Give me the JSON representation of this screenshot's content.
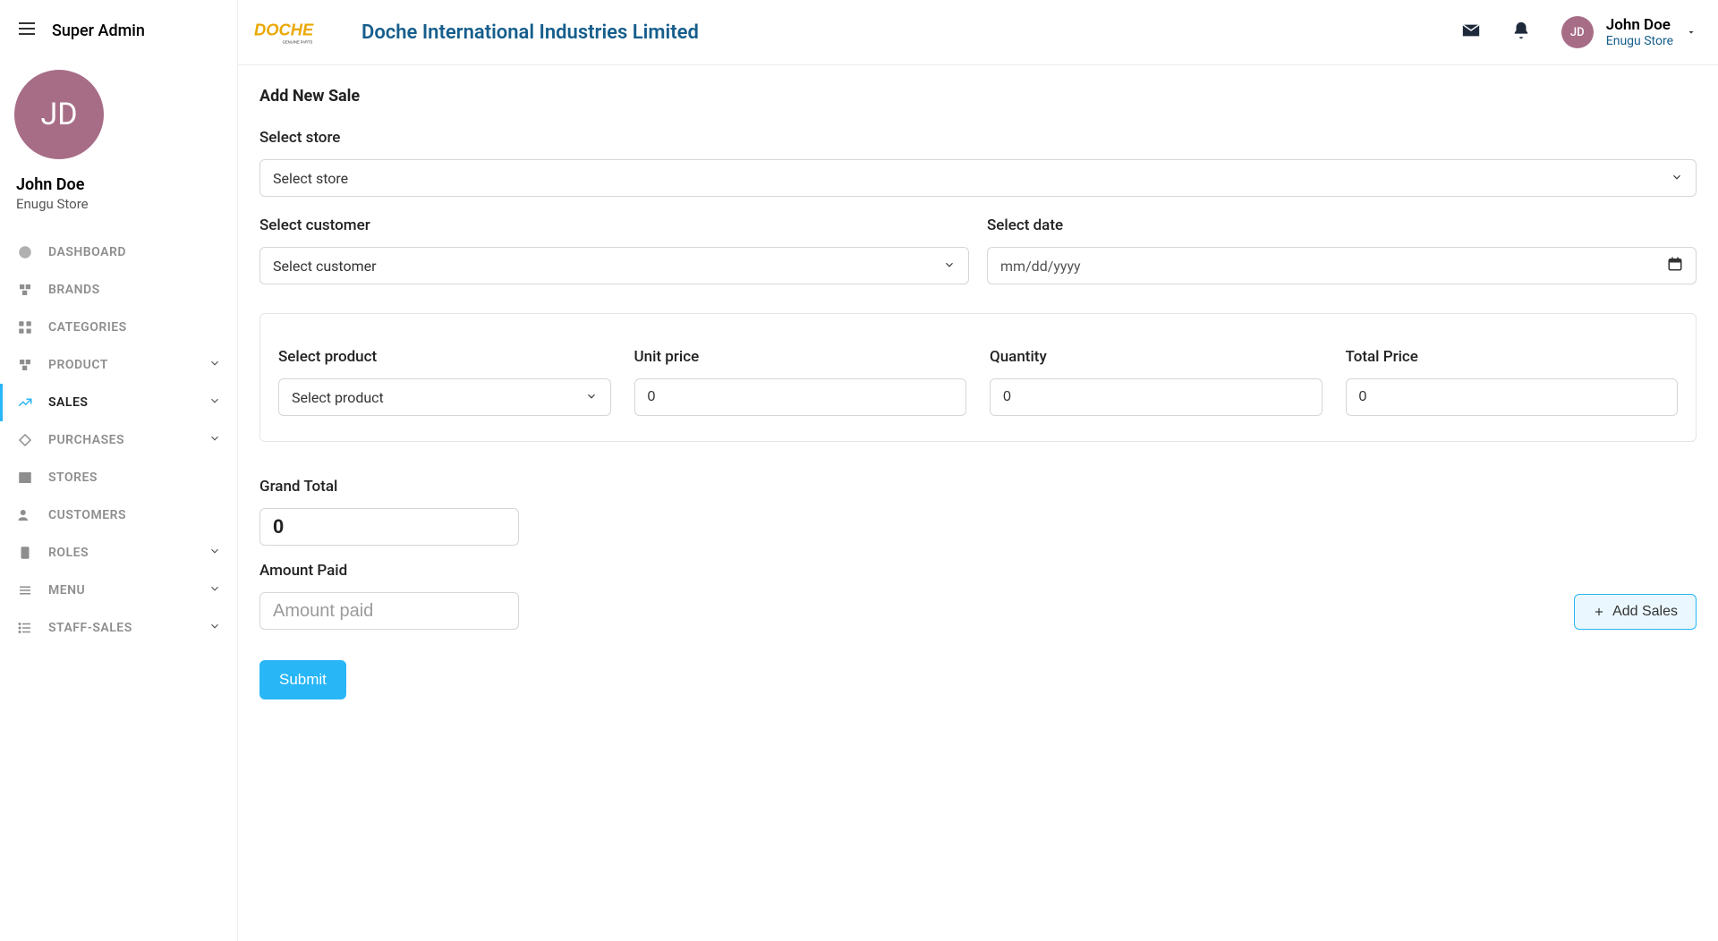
{
  "sidebar": {
    "title": "Super Admin",
    "avatar_initials": "JD",
    "user_name": "John Doe",
    "user_store": "Enugu Store",
    "items": [
      {
        "label": "Dashboard",
        "icon": "dashboard",
        "expandable": false,
        "active": false
      },
      {
        "label": "Brands",
        "icon": "brands",
        "expandable": false,
        "active": false
      },
      {
        "label": "Categories",
        "icon": "categories",
        "expandable": false,
        "active": false
      },
      {
        "label": "Product",
        "icon": "product",
        "expandable": true,
        "active": false
      },
      {
        "label": "Sales",
        "icon": "sales",
        "expandable": true,
        "active": true
      },
      {
        "label": "Purchases",
        "icon": "purchases",
        "expandable": true,
        "active": false
      },
      {
        "label": "Stores",
        "icon": "stores",
        "expandable": false,
        "active": false
      },
      {
        "label": "Customers",
        "icon": "customers",
        "expandable": false,
        "active": false
      },
      {
        "label": "Roles",
        "icon": "roles",
        "expandable": true,
        "active": false
      },
      {
        "label": "Menu",
        "icon": "menu",
        "expandable": true,
        "active": false
      },
      {
        "label": "Staff-Sales",
        "icon": "list",
        "expandable": true,
        "active": false
      }
    ]
  },
  "topbar": {
    "company": "Doche International Industries Limited",
    "user_avatar_initials": "JD",
    "user_name": "John Doe",
    "user_store": "Enugu Store"
  },
  "page": {
    "title": "Add New Sale",
    "labels": {
      "select_store": "Select store",
      "select_customer": "Select customer",
      "select_date": "Select date",
      "select_product": "Select product",
      "unit_price": "Unit price",
      "quantity": "Quantity",
      "total_price": "Total Price",
      "grand_total": "Grand Total",
      "amount_paid": "Amount Paid"
    },
    "placeholders": {
      "select_store": "Select store",
      "select_customer": "Select customer",
      "select_product": "Select product",
      "date": "mm/dd/yyyy",
      "amount_paid": "Amount paid"
    },
    "values": {
      "unit_price": "0",
      "quantity": "0",
      "total_price": "0",
      "grand_total": "0"
    },
    "buttons": {
      "add_sales": "Add Sales",
      "submit": "Submit"
    }
  }
}
